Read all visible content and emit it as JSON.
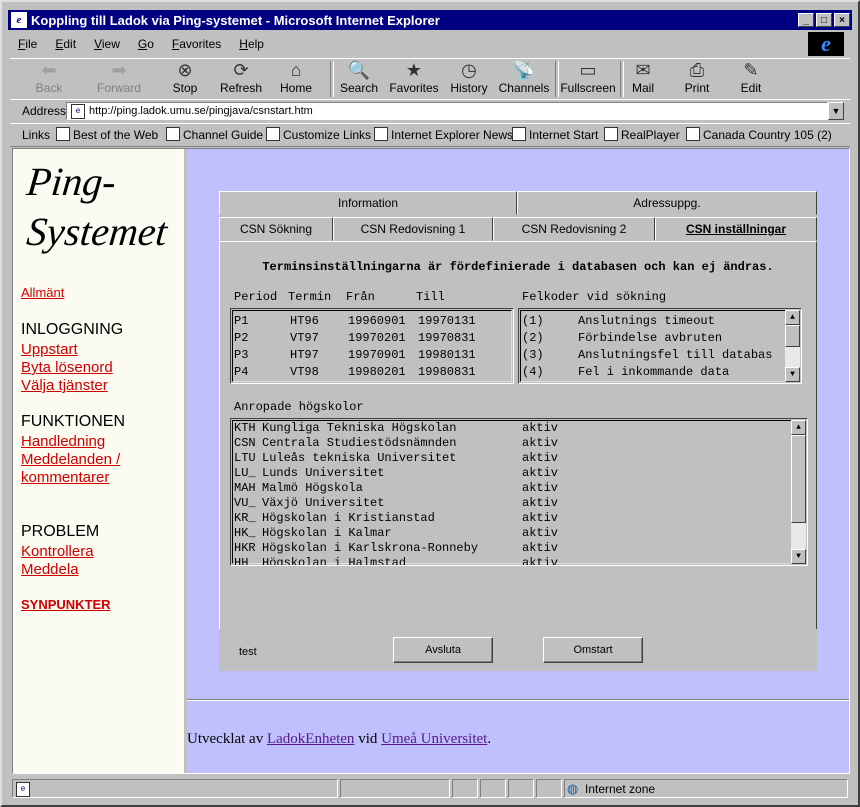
{
  "window": {
    "title": "Koppling till Ladok via Ping-systemet - Microsoft Internet Explorer",
    "controls": [
      "_",
      "□",
      "×"
    ]
  },
  "menu": [
    "File",
    "Edit",
    "View",
    "Go",
    "Favorites",
    "Help"
  ],
  "toolbar": [
    {
      "label": "Back",
      "icon": "back-arrow-icon",
      "glyph": "⬅",
      "enabled": false
    },
    {
      "label": "Forward",
      "icon": "forward-arrow-icon",
      "glyph": "➡",
      "enabled": false
    },
    {
      "label": "Stop",
      "icon": "stop-icon",
      "glyph": "⊗",
      "enabled": true
    },
    {
      "label": "Refresh",
      "icon": "refresh-icon",
      "glyph": "⟳",
      "enabled": true
    },
    {
      "label": "Home",
      "icon": "home-icon",
      "glyph": "⌂",
      "enabled": true
    },
    {
      "label": "Search",
      "icon": "search-icon",
      "glyph": "🔍",
      "enabled": true
    },
    {
      "label": "Favorites",
      "icon": "favorites-icon",
      "glyph": "★",
      "enabled": true
    },
    {
      "label": "History",
      "icon": "history-icon",
      "glyph": "◷",
      "enabled": true
    },
    {
      "label": "Channels",
      "icon": "channels-icon",
      "glyph": "📡",
      "enabled": true
    },
    {
      "label": "Fullscreen",
      "icon": "fullscreen-icon",
      "glyph": "▭",
      "enabled": true
    },
    {
      "label": "Mail",
      "icon": "mail-icon",
      "glyph": "✉",
      "enabled": true
    },
    {
      "label": "Print",
      "icon": "print-icon",
      "glyph": "⎙",
      "enabled": true
    },
    {
      "label": "Edit",
      "icon": "edit-icon",
      "glyph": "✎",
      "enabled": true
    }
  ],
  "address": {
    "label": "Address",
    "url": "http://ping.ladok.umu.se/pingjava/csnstart.htm"
  },
  "links": {
    "label": "Links",
    "items": [
      "Best of the Web",
      "Channel Guide",
      "Customize Links",
      "Internet Explorer News",
      "Internet Start",
      "RealPlayer",
      "Canada Country 105  (2)"
    ]
  },
  "sidebar": {
    "logo_line1": "Ping-",
    "logo_line2": "Systemet",
    "allmant": "Allmänt",
    "inloggning": "INLOGGNING",
    "uppstart": "Uppstart",
    "byta": "Byta lösenord",
    "valja": "Välja tjänster",
    "funktionen": "FUNKTIONEN",
    "handledning": "Handledning",
    "meddelanden1": "Meddelanden /",
    "meddelanden2": "kommentarer",
    "problem": "PROBLEM",
    "kontrollera": "Kontrollera",
    "meddela": "Meddela",
    "synpunkter": "SYNPUNKTER"
  },
  "applet": {
    "tabs_top": [
      "Information",
      "Adressuppg."
    ],
    "tabs_bottom": [
      "CSN Sökning",
      "CSN Redovisning 1",
      "CSN Redovisning 2",
      "CSN inställningar"
    ],
    "heading": "Terminsinställningarna är fördefinierade i databasen och kan ej ändras.",
    "period_headers": [
      "Period",
      "Termin",
      "Från",
      "Till"
    ],
    "periods": [
      [
        "P1",
        "HT96",
        "19960901",
        "19970131"
      ],
      [
        "P2",
        "VT97",
        "19970201",
        "19970831"
      ],
      [
        "P3",
        "HT97",
        "19970901",
        "19980131"
      ],
      [
        "P4",
        "VT98",
        "19980201",
        "19980831"
      ]
    ],
    "error_header": "Felkoder vid sökning",
    "errors": [
      [
        "(1)",
        "Anslutnings timeout"
      ],
      [
        "(2)",
        "Förbindelse avbruten"
      ],
      [
        "(3)",
        "Anslutningsfel till databas"
      ],
      [
        "(4)",
        "Fel i inkommande data"
      ]
    ],
    "schools_header": "Anropade högskolor",
    "schools": [
      [
        "KTH",
        "Kungliga Tekniska Högskolan",
        "aktiv"
      ],
      [
        "CSN",
        "Centrala Studiestödsnämnden",
        "aktiv"
      ],
      [
        "LTU",
        "Luleås tekniska Universitet",
        "aktiv"
      ],
      [
        "LU_",
        "Lunds Universitet",
        "aktiv"
      ],
      [
        "MAH",
        "Malmö Högskola",
        "aktiv"
      ],
      [
        "VU_",
        "Växjö Universitet",
        "aktiv"
      ],
      [
        "KR_",
        "Högskolan i Kristianstad",
        "aktiv"
      ],
      [
        "HK_",
        "Högskolan i Kalmar",
        "aktiv"
      ],
      [
        "HKR",
        "Högskolan i Karlskrona-Ronneby",
        "aktiv"
      ],
      [
        "HH_",
        "Högskolan i Halmstad",
        "aktiv"
      ]
    ],
    "status": "test",
    "avsluta": "Avsluta",
    "omstart": "Omstart"
  },
  "credit": {
    "prefix": "Utvecklat av ",
    "link1": "LadokEnheten",
    "mid": " vid ",
    "link2": "Umeå Universitet",
    "suffix": "."
  },
  "statusbar": {
    "zone": "Internet zone"
  }
}
